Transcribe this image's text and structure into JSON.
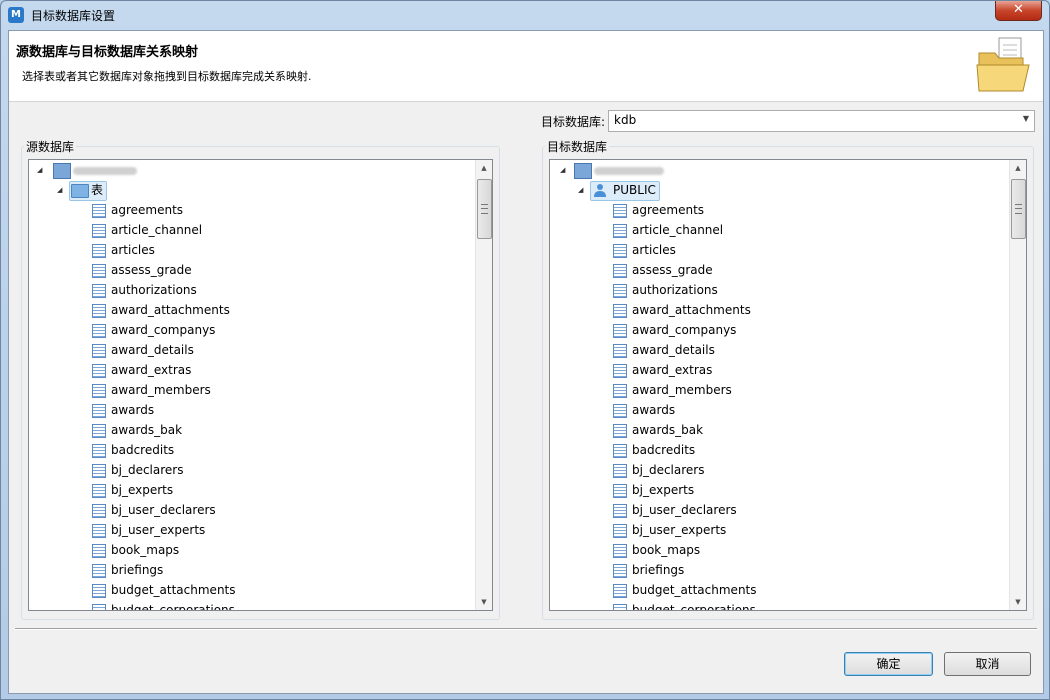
{
  "window": {
    "title": "目标数据库设置",
    "close_glyph": "✕",
    "app_icon_glyph": "M"
  },
  "header": {
    "title": "源数据库与目标数据库关系映射",
    "description": "选择表或者其它数据库对象拖拽到目标数据库完成关系映射."
  },
  "target_selector": {
    "label": "目标数据库:",
    "value": "kdb"
  },
  "source_panel": {
    "group_label": "源数据库",
    "folder_label": "表",
    "tables": [
      "agreements",
      "article_channel",
      "articles",
      "assess_grade",
      "authorizations",
      "award_attachments",
      "award_companys",
      "award_details",
      "award_extras",
      "award_members",
      "awards",
      "awards_bak",
      "badcredits",
      "bj_declarers",
      "bj_experts",
      "bj_user_declarers",
      "bj_user_experts",
      "book_maps",
      "briefings",
      "budget_attachments",
      "budget_corporations"
    ]
  },
  "target_panel": {
    "group_label": "目标数据库",
    "schema_label": "PUBLIC",
    "tables": [
      "agreements",
      "article_channel",
      "articles",
      "assess_grade",
      "authorizations",
      "award_attachments",
      "award_companys",
      "award_details",
      "award_extras",
      "award_members",
      "awards",
      "awards_bak",
      "badcredits",
      "bj_declarers",
      "bj_experts",
      "bj_user_declarers",
      "bj_user_experts",
      "book_maps",
      "briefings",
      "budget_attachments",
      "budget_corporations"
    ]
  },
  "buttons": {
    "ok": "确定",
    "cancel": "取消"
  },
  "colors": {
    "accent": "#2a78c8",
    "selection": "#dcecf9"
  }
}
